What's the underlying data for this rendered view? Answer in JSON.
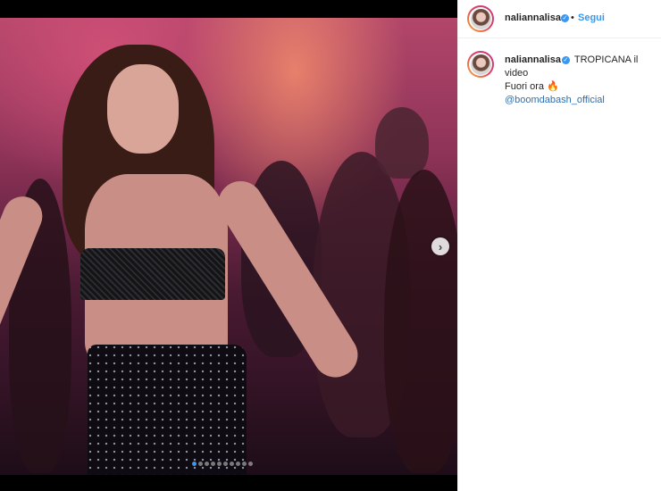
{
  "post": {
    "username": "naliannalisa",
    "follow_label": "Segui",
    "separator": "•",
    "caption": {
      "username": "naliannalisa",
      "line1": "TROPICANA il video",
      "line2": "Fuori ora",
      "emoji": "🔥",
      "mention": "@boomdabash_official"
    },
    "next_arrow": "›",
    "carousel": {
      "total": 10,
      "current": 1
    }
  },
  "colors": {
    "accent": "#3897f0",
    "text": "#262626",
    "mention": "#2f6fb0"
  },
  "icons": {
    "verified": "verified-badge-icon",
    "next": "chevron-right-icon",
    "fire": "fire-emoji-icon"
  }
}
